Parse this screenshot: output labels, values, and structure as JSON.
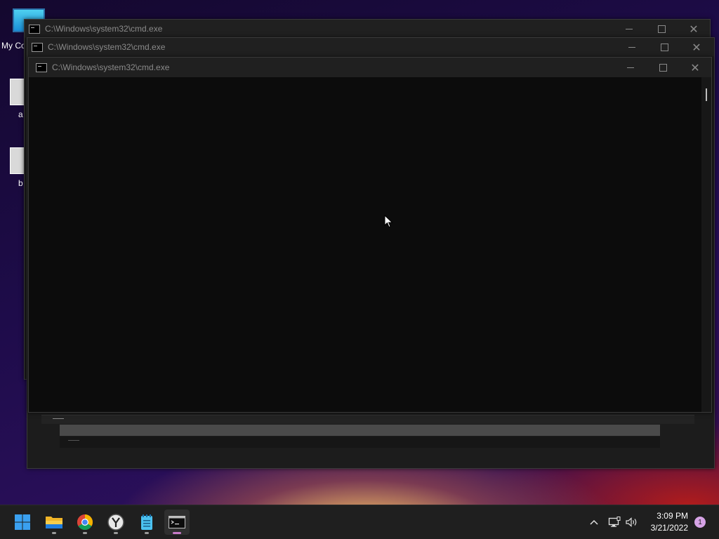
{
  "desktop": {
    "icons": [
      {
        "label": "My Co"
      },
      {
        "label": "a"
      },
      {
        "label": "b"
      }
    ]
  },
  "windows": [
    {
      "title": "C:\\Windows\\system32\\cmd.exe"
    },
    {
      "title": "C:\\Windows\\system32\\cmd.exe"
    },
    {
      "title": "C:\\Windows\\system32\\cmd.exe"
    }
  ],
  "taskbar": {
    "apps": [
      {
        "name": "start",
        "icon": "windows-logo-icon"
      },
      {
        "name": "file-explorer",
        "icon": "folder-icon"
      },
      {
        "name": "chrome",
        "icon": "chrome-icon"
      },
      {
        "name": "yandex-browser",
        "icon": "yandex-icon"
      },
      {
        "name": "notepad",
        "icon": "notepad-icon"
      },
      {
        "name": "cmd",
        "icon": "terminal-icon"
      }
    ],
    "time": "3:09 PM",
    "date": "3/21/2022",
    "notification_count": "1"
  },
  "colors": {
    "taskbar": "#1f1f1f",
    "console_bg": "#0c0c0c",
    "accent_pip": "#c77ac8"
  }
}
